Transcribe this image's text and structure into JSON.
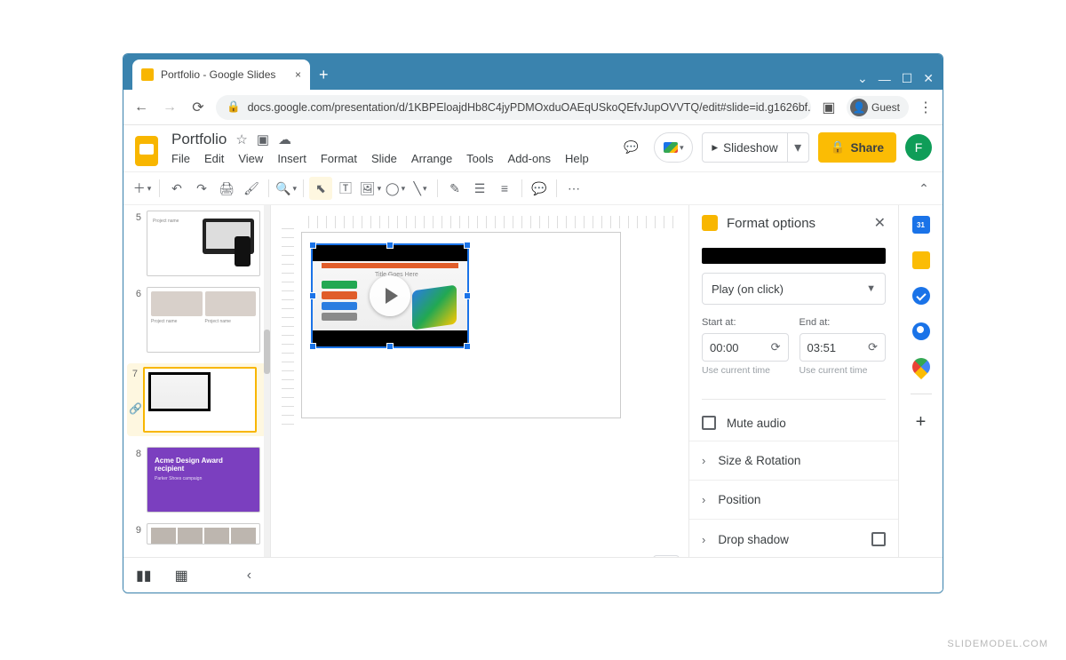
{
  "browser": {
    "tab_title": "Portfolio - Google Slides",
    "url": "docs.google.com/presentation/d/1KBPEloajdHb8C4jyPDMOxduOAEqUSkoQEfvJupOVVTQ/edit#slide=id.g1626bf...",
    "guest_label": "Guest"
  },
  "app": {
    "title": "Portfolio",
    "menus": [
      "File",
      "Edit",
      "View",
      "Insert",
      "Format",
      "Slide",
      "Arrange",
      "Tools",
      "Add-ons",
      "Help"
    ],
    "slideshow_label": "Slideshow",
    "share_label": "Share",
    "user_initial": "F"
  },
  "filmstrip": {
    "slides": [
      {
        "num": "5",
        "kind": "laptop",
        "label": "Project name"
      },
      {
        "num": "6",
        "kind": "grid",
        "labels": [
          "Project name",
          "Project name"
        ]
      },
      {
        "num": "7",
        "kind": "video",
        "active": true
      },
      {
        "num": "8",
        "kind": "purple",
        "title": "Acme Design Award recipient",
        "subtitle": "Parker Shoes campaign"
      },
      {
        "num": "9",
        "kind": "strip"
      }
    ]
  },
  "canvas": {
    "selected_element": "video",
    "video_title_placeholder": "Title Goes Here"
  },
  "panel": {
    "title": "Format options",
    "play_mode": "Play (on click)",
    "start_label": "Start at:",
    "end_label": "End at:",
    "start_value": "00:00",
    "end_value": "03:51",
    "use_current": "Use current time",
    "mute_label": "Mute audio",
    "sections": [
      "Size & Rotation",
      "Position",
      "Drop shadow"
    ]
  },
  "watermark": "SLIDEMODEL.COM"
}
